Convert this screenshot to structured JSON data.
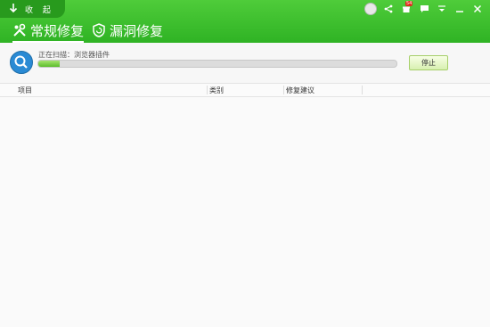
{
  "header": {
    "collapse_label": "收 起",
    "tabs": [
      {
        "label": "常规修复",
        "active": true
      },
      {
        "label": "漏洞修复",
        "active": false
      }
    ],
    "notification_badge": "54",
    "accent_color": "#3cbf2c"
  },
  "scan": {
    "status": "正在扫描：浏览器插件",
    "progress": 0.06,
    "stop_label": "停止"
  },
  "table": {
    "columns": [
      "项目",
      "类别",
      "修复建议"
    ]
  }
}
